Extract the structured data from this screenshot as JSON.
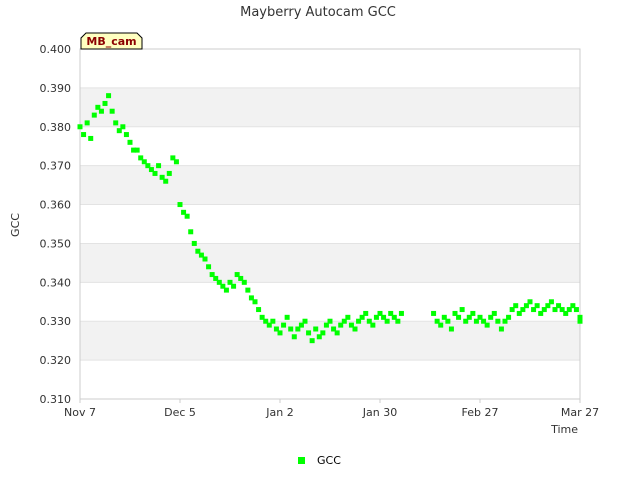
{
  "chart_data": {
    "type": "scatter",
    "title": "Mayberry Autocam GCC",
    "xlabel": "Time",
    "ylabel": "GCC",
    "site_badge": "MB_cam",
    "x_ticks": [
      "Nov 7",
      "Dec 5",
      "Jan 2",
      "Jan 30",
      "Feb 27",
      "Mar 27"
    ],
    "y_ticks": [
      "0.310",
      "0.320",
      "0.330",
      "0.340",
      "0.350",
      "0.360",
      "0.370",
      "0.380",
      "0.390",
      "0.400"
    ],
    "xlim": [
      "Nov 7",
      "Mar 27"
    ],
    "ylim": [
      0.31,
      0.4
    ],
    "grid": true,
    "legend_position": "bottom-center",
    "colors": {
      "series": "#00ff00",
      "band": "#f2f2f2",
      "badge_fill": "#ffffc0"
    },
    "series": [
      {
        "name": "GCC",
        "x": [
          "Nov 7",
          "Nov 8",
          "Nov 9",
          "Nov 10",
          "Nov 11",
          "Nov 12",
          "Nov 13",
          "Nov 14",
          "Nov 15",
          "Nov 16",
          "Nov 17",
          "Nov 18",
          "Nov 19",
          "Nov 20",
          "Nov 21",
          "Nov 22",
          "Nov 23",
          "Nov 24",
          "Nov 25",
          "Nov 26",
          "Nov 27",
          "Nov 28",
          "Nov 29",
          "Nov 30",
          "Dec 1",
          "Dec 2",
          "Dec 3",
          "Dec 4",
          "Dec 5",
          "Dec 6",
          "Dec 7",
          "Dec 8",
          "Dec 9",
          "Dec 10",
          "Dec 11",
          "Dec 12",
          "Dec 13",
          "Dec 14",
          "Dec 15",
          "Dec 16",
          "Dec 17",
          "Dec 18",
          "Dec 19",
          "Dec 20",
          "Dec 21",
          "Dec 22",
          "Dec 23",
          "Dec 24",
          "Dec 25",
          "Dec 26",
          "Dec 27",
          "Dec 28",
          "Dec 29",
          "Dec 30",
          "Dec 31",
          "Jan 1",
          "Jan 2",
          "Jan 3",
          "Jan 4",
          "Jan 5",
          "Jan 6",
          "Jan 7",
          "Jan 8",
          "Jan 9",
          "Jan 10",
          "Jan 11",
          "Jan 12",
          "Jan 13",
          "Jan 14",
          "Jan 15",
          "Jan 16",
          "Jan 17",
          "Jan 18",
          "Jan 19",
          "Jan 20",
          "Jan 21",
          "Jan 22",
          "Jan 23",
          "Jan 24",
          "Jan 25",
          "Jan 26",
          "Jan 27",
          "Jan 28",
          "Jan 29",
          "Jan 30",
          "Jan 31",
          "Feb 1",
          "Feb 2",
          "Feb 3",
          "Feb 4",
          "Feb 5",
          "Feb 14",
          "Feb 15",
          "Feb 16",
          "Feb 17",
          "Feb 18",
          "Feb 19",
          "Feb 20",
          "Feb 21",
          "Feb 22",
          "Feb 23",
          "Feb 24",
          "Feb 25",
          "Feb 26",
          "Feb 27",
          "Feb 28",
          "Mar 1",
          "Mar 2",
          "Mar 3",
          "Mar 4",
          "Mar 5",
          "Mar 6",
          "Mar 7",
          "Mar 8",
          "Mar 9",
          "Mar 10",
          "Mar 11",
          "Mar 12",
          "Mar 13",
          "Mar 14",
          "Mar 15",
          "Mar 16",
          "Mar 17",
          "Mar 18",
          "Mar 19",
          "Mar 20",
          "Mar 21",
          "Mar 22",
          "Mar 23",
          "Mar 24",
          "Mar 25",
          "Mar 26",
          "Mar 27",
          "Mar 27"
        ],
        "y": [
          0.38,
          0.378,
          0.381,
          0.377,
          0.383,
          0.385,
          0.384,
          0.386,
          0.388,
          0.384,
          0.381,
          0.379,
          0.38,
          0.378,
          0.376,
          0.374,
          0.374,
          0.372,
          0.371,
          0.37,
          0.369,
          0.368,
          0.37,
          0.367,
          0.366,
          0.368,
          0.372,
          0.371,
          0.36,
          0.358,
          0.357,
          0.353,
          0.35,
          0.348,
          0.347,
          0.346,
          0.344,
          0.342,
          0.341,
          0.34,
          0.339,
          0.338,
          0.34,
          0.339,
          0.342,
          0.341,
          0.34,
          0.338,
          0.336,
          0.335,
          0.333,
          0.331,
          0.33,
          0.329,
          0.33,
          0.328,
          0.327,
          0.329,
          0.331,
          0.328,
          0.326,
          0.328,
          0.329,
          0.33,
          0.327,
          0.325,
          0.328,
          0.326,
          0.327,
          0.329,
          0.33,
          0.328,
          0.327,
          0.329,
          0.33,
          0.331,
          0.329,
          0.328,
          0.33,
          0.331,
          0.332,
          0.33,
          0.329,
          0.331,
          0.332,
          0.331,
          0.33,
          0.332,
          0.331,
          0.33,
          0.332,
          0.332,
          0.33,
          0.329,
          0.331,
          0.33,
          0.328,
          0.332,
          0.331,
          0.333,
          0.33,
          0.331,
          0.332,
          0.33,
          0.331,
          0.33,
          0.329,
          0.331,
          0.332,
          0.33,
          0.328,
          0.33,
          0.331,
          0.333,
          0.334,
          0.332,
          0.333,
          0.334,
          0.335,
          0.333,
          0.334,
          0.332,
          0.333,
          0.334,
          0.335,
          0.333,
          0.334,
          0.333,
          0.332,
          0.333,
          0.334,
          0.333,
          0.331,
          0.33
        ]
      }
    ]
  }
}
